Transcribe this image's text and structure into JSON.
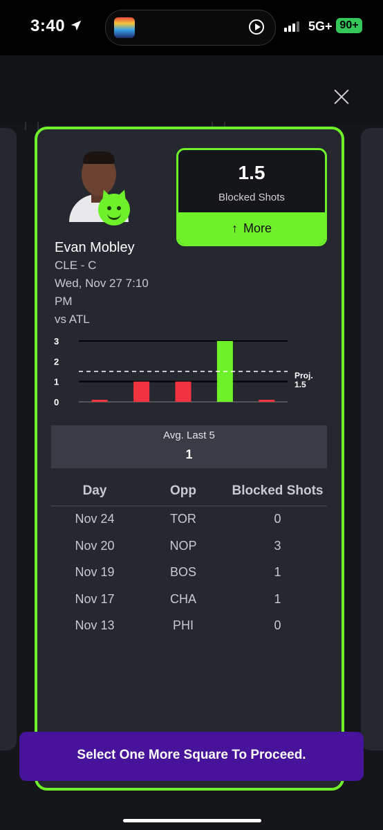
{
  "status_bar": {
    "time": "3:40",
    "network": "5G+",
    "battery": "90+"
  },
  "player": {
    "name": "Evan Mobley",
    "team_pos": "CLE - C",
    "game_time_line1": "Wed, Nov 27 7:10",
    "game_time_line2": "PM",
    "opponent": "vs ATL"
  },
  "pick": {
    "line": "1.5",
    "stat": "Blocked Shots",
    "more_label": "More"
  },
  "chart_data": {
    "type": "bar",
    "values": [
      0,
      1,
      1,
      3,
      0
    ],
    "ylim": [
      0,
      3
    ],
    "yticks": [
      "0",
      "1",
      "2",
      "3"
    ],
    "projection": {
      "label_line1": "Proj.",
      "label_line2": "1.5",
      "value": 1.5
    },
    "colors": {
      "over": "#6ef12a",
      "under": "#ef3340"
    }
  },
  "average": {
    "label": "Avg. Last 5",
    "value": "1"
  },
  "table": {
    "headers": [
      "Day",
      "Opp",
      "Blocked Shots"
    ],
    "rows": [
      [
        "Nov 24",
        "TOR",
        "0"
      ],
      [
        "Nov 20",
        "NOP",
        "3"
      ],
      [
        "Nov 19",
        "BOS",
        "1"
      ],
      [
        "Nov 17",
        "CHA",
        "1"
      ],
      [
        "Nov 13",
        "PHI",
        "0"
      ]
    ]
  },
  "toast": {
    "message": "Select One More Square To Proceed."
  }
}
